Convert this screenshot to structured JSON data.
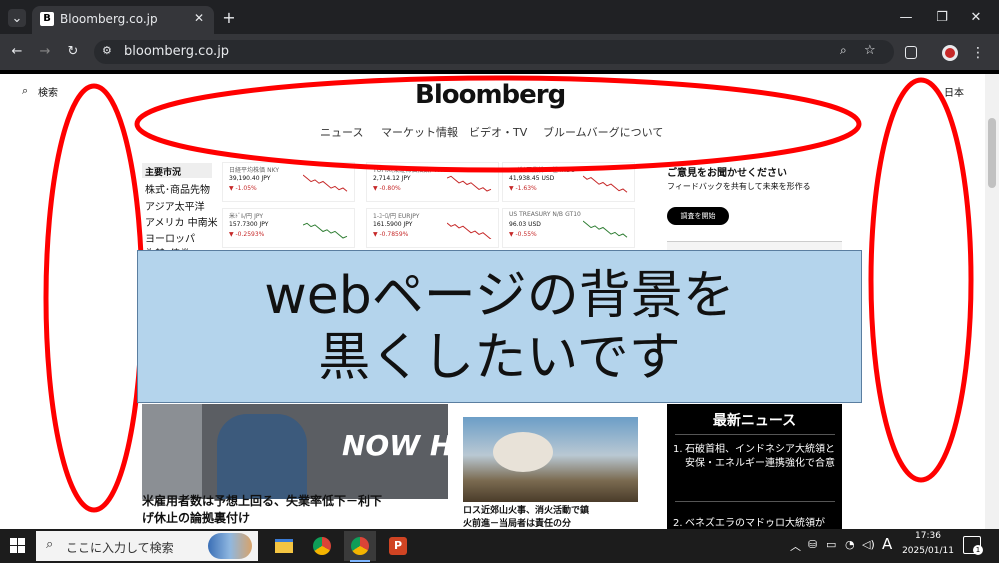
{
  "browser": {
    "tab_title": "Bloomberg.co.jp",
    "favicon_letter": "B",
    "url": "bloomberg.co.jp",
    "tab_close": "✕",
    "new_tab": "+",
    "win_min": "—",
    "win_max": "❐",
    "win_close": "✕"
  },
  "page": {
    "search_label": "検索",
    "logo": "Bloomberg",
    "region": "日本",
    "nav": [
      "ニュース",
      "マーケット情報",
      "ビデオ・TV",
      "ブルームバーグについて"
    ],
    "sidebar": [
      "主要市況",
      "株式･商品先物",
      "アジア太平洋",
      "アメリカ 中南米",
      "ヨーロッパ",
      "為替･債券"
    ],
    "cards": [
      {
        "name": "日経平均株価",
        "code": "NKY",
        "value": "39,190.40 JPY",
        "change": "▼ -1.05%"
      },
      {
        "name": "TOPIX(東証株価指数)",
        "code": "TPX",
        "value": "2,714.12 JPY",
        "change": "▼ -0.80%"
      },
      {
        "name": "NYﾀﾞｳ工業株30種",
        "code": "INDU",
        "value": "41,938.45 USD",
        "change": "▼ -1.63%"
      },
      {
        "name": "米ﾄﾞﾙ/円",
        "code": "JPY",
        "value": "157.7300 JPY",
        "change": "▼ -0.2593%"
      },
      {
        "name": "1-ﾕｰﾛ/円",
        "code": "EURJPY",
        "value": "161.5900 JPY",
        "change": "▼ -0.7859%"
      },
      {
        "name": "US TREASURY N/B",
        "code": "GT10",
        "value": "96.03 USD",
        "change": "▼ -0.55%"
      }
    ],
    "feedback_title": "ご意見をお聞かせください",
    "feedback_sub": "フィードバックを共有して未来を形作る",
    "feedback_button": "調査を開始",
    "headline1": "米雇用者数は予想上回る、失業率低下－利下げ休止の論拠裏付け",
    "headline2": "ロス近郊山火事、消火活動で鎮火前進－当局者は責任の分",
    "hiring_text": "NOW HIRING!",
    "latest_title": "最新ニュース",
    "latest": [
      {
        "num": "1.",
        "text": "石破首相、インドネシア大統領と安保・エネルギー連携強化で合意"
      },
      {
        "num": "2.",
        "text": "ベネズエラのマドゥロ大統領が"
      }
    ]
  },
  "annotation": {
    "line1": "webページの背景を",
    "line2": "黒くしたいです",
    "ellipse_color": "#ff0000"
  },
  "taskbar": {
    "search_placeholder": "ここに入力して検索",
    "time": "17:36",
    "date": "2025/01/11",
    "ime": "A",
    "notif_count": "1"
  }
}
